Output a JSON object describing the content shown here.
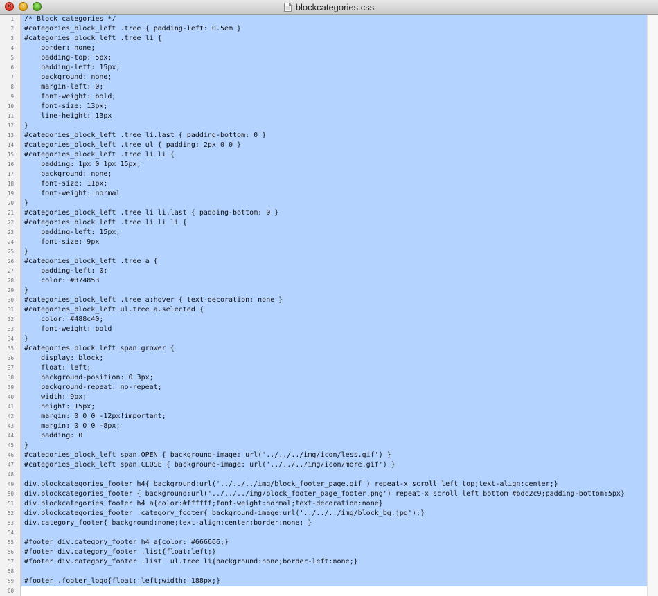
{
  "window": {
    "title": "blockcategories.css",
    "file_icon": "document-icon",
    "close_icon": "close-icon",
    "minimize_icon": "minimize-icon",
    "zoom_icon": "zoom-icon"
  },
  "colors": {
    "selection": "#b5d3ff",
    "gutter_bg": "#f2f2f2",
    "line_number": "#7a7a7a",
    "text": "#111111"
  },
  "editor": {
    "lines": [
      "/* Block categories */",
      "#categories_block_left .tree { padding-left: 0.5em }",
      "#categories_block_left .tree li {",
      "    border: none;",
      "    padding-top: 5px;",
      "    padding-left: 15px;",
      "    background: none;",
      "    margin-left: 0;",
      "    font-weight: bold;",
      "    font-size: 13px;",
      "    line-height: 13px",
      "}",
      "#categories_block_left .tree li.last { padding-bottom: 0 }",
      "#categories_block_left .tree ul { padding: 2px 0 0 }",
      "#categories_block_left .tree li li {",
      "    padding: 1px 0 1px 15px;",
      "    background: none;",
      "    font-size: 11px;",
      "    font-weight: normal",
      "}",
      "#categories_block_left .tree li li.last { padding-bottom: 0 }",
      "#categories_block_left .tree li li li {",
      "    padding-left: 15px;",
      "    font-size: 9px",
      "}",
      "#categories_block_left .tree a {",
      "    padding-left: 0;",
      "    color: #374853",
      "}",
      "#categories_block_left .tree a:hover { text-decoration: none }",
      "#categories_block_left ul.tree a.selected {",
      "    color: #488c40;",
      "    font-weight: bold",
      "}",
      "#categories_block_left span.grower {",
      "    display: block;",
      "    float: left;",
      "    background-position: 0 3px;",
      "    background-repeat: no-repeat;",
      "    width: 9px;",
      "    height: 15px;",
      "    margin: 0 0 0 -12px!important;",
      "    margin: 0 0 0 -8px;",
      "    padding: 0",
      "}",
      "#categories_block_left span.OPEN { background-image: url('../../../img/icon/less.gif') }",
      "#categories_block_left span.CLOSE { background-image: url('../../../img/icon/more.gif') }",
      "",
      "div.blockcategories_footer h4{ background:url('../../../img/block_footer_page.gif') repeat-x scroll left top;text-align:center;}",
      "div.blockcategories_footer { background:url('../../../img/block_footer_page_footer.png') repeat-x scroll left bottom #bdc2c9;padding-bottom:5px}",
      "div.blockcategories_footer h4 a{color:#ffffff;font-weight:normal;text-decoration:none}",
      "div.blockcategories_footer .category_footer{ background-image:url('../../../img/block_bg.jpg');}",
      "div.category_footer{ background:none;text-align:center;border:none; }",
      "",
      "#footer div.category_footer h4 a{color: #666666;}",
      "#footer div.category_footer .list{float:left;}",
      "#footer div.category_footer .list  ul.tree li{background:none;border-left:none;}",
      "",
      "#footer .footer_logo{float: left;width: 188px;}",
      ""
    ],
    "line_numbers": [
      "1",
      "2",
      "3",
      "4",
      "5",
      "6",
      "7",
      "8",
      "9",
      "10",
      "11",
      "12",
      "13",
      "14",
      "15",
      "16",
      "17",
      "18",
      "19",
      "20",
      "21",
      "22",
      "23",
      "24",
      "25",
      "26",
      "27",
      "28",
      "29",
      "30",
      "31",
      "32",
      "33",
      "34",
      "35",
      "36",
      "37",
      "38",
      "39",
      "40",
      "41",
      "42",
      "43",
      "44",
      "45",
      "46",
      "47",
      "48",
      "49",
      "50",
      "51",
      "52",
      "53",
      "54",
      "55",
      "56",
      "57",
      "58",
      "59",
      "60"
    ]
  }
}
